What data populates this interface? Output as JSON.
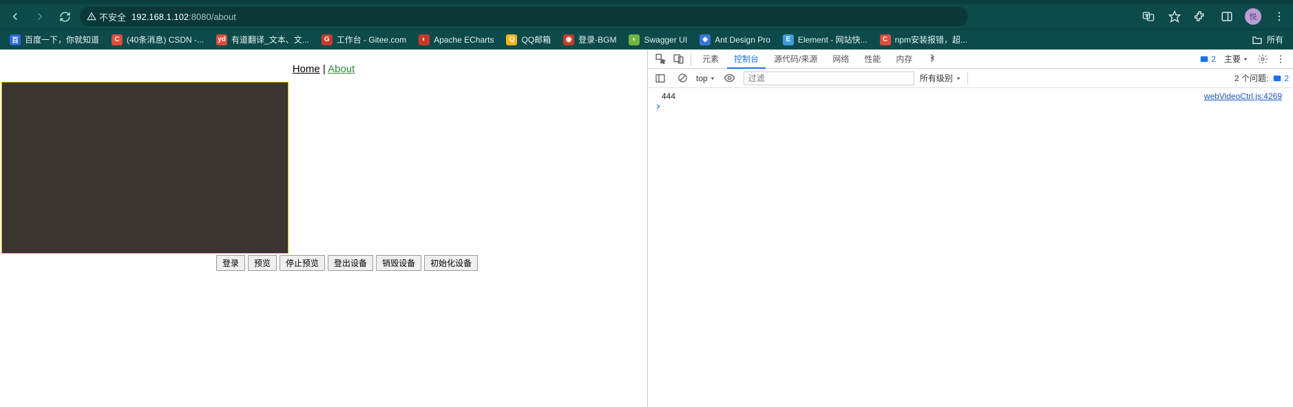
{
  "browser": {
    "address_prefix": "不安全",
    "address_host": "192.168.1.102",
    "address_port": ":8080",
    "address_path": "/about",
    "avatar_initial": "悦"
  },
  "bookmarks": {
    "items": [
      {
        "label": "百度一下，你就知道"
      },
      {
        "label": "(40条消息) CSDN -..."
      },
      {
        "label": "有道翻译_文本、文..."
      },
      {
        "label": "工作台 - Gitee.com"
      },
      {
        "label": "Apache ECharts"
      },
      {
        "label": "QQ邮箱"
      },
      {
        "label": "登录-BGM"
      },
      {
        "label": "Swagger UI"
      },
      {
        "label": "Ant Design Pro"
      },
      {
        "label": "Element - 网站快..."
      },
      {
        "label": "npm安装报错，超..."
      }
    ],
    "all_label": "所有"
  },
  "page": {
    "nav_home": "Home",
    "nav_sep": " | ",
    "nav_about": "About",
    "buttons": {
      "login": "登录",
      "preview": "预览",
      "stop_preview": "停止预览",
      "logout_device": "登出设备",
      "destroy_device": "销毁设备",
      "init_device": "初始化设备"
    }
  },
  "devtools": {
    "tabs": {
      "elements": "元素",
      "console": "控制台",
      "sources": "源代码/来源",
      "network": "网络",
      "performance": "性能",
      "memory": "内存"
    },
    "badge_count": "2",
    "level_selector": "主要",
    "console_toolbar": {
      "context": "top",
      "filter_placeholder": "过滤",
      "levels": "所有级别",
      "issues_label": "2 个问题:",
      "issues_count": "2"
    },
    "log": {
      "message": "444",
      "source": "webVideoCtrl.js:4269"
    }
  }
}
